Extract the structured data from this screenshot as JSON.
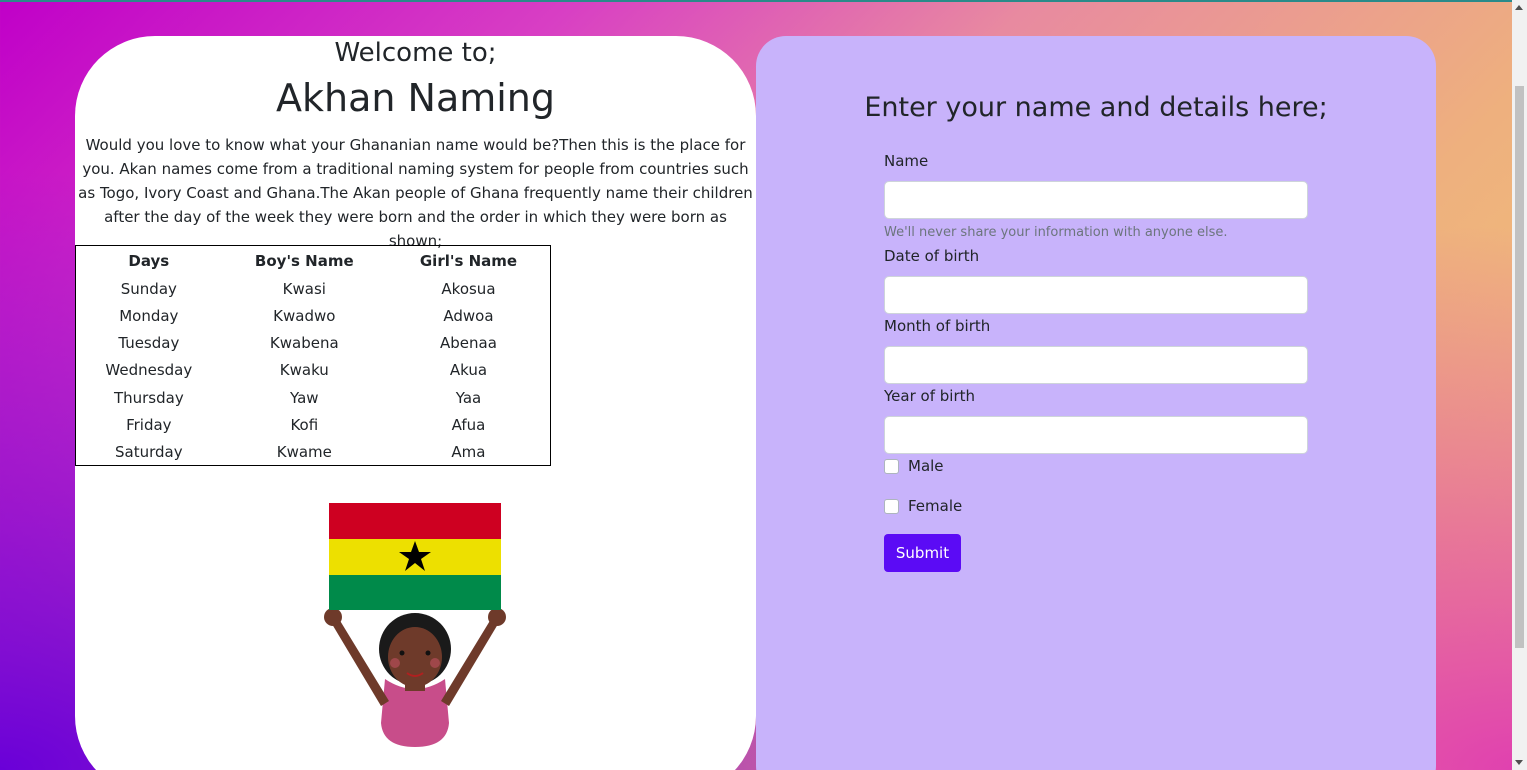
{
  "hero": {
    "welcome": "Welcome to;",
    "title": "Akhan Naming",
    "intro": "Would you love to know what your Ghananian name would be?Then this is the place for you. Akan names come from a traditional naming system for people from countries such as Togo, Ivory Coast and Ghana.The Akan people of Ghana frequently name their children after the day of the week they were born and the order in which they were born as shown;"
  },
  "table": {
    "headers": [
      "Days",
      "Boy's Name",
      "Girl's Name"
    ],
    "rows": [
      [
        "Sunday",
        "Kwasi",
        "Akosua"
      ],
      [
        "Monday",
        "Kwadwo",
        "Adwoa"
      ],
      [
        "Tuesday",
        "Kwabena",
        "Abenaa"
      ],
      [
        "Wednesday",
        "Kwaku",
        "Akua"
      ],
      [
        "Thursday",
        "Yaw",
        "Yaa"
      ],
      [
        "Friday",
        "Kofi",
        "Afua"
      ],
      [
        "Saturday",
        "Kwame",
        "Ama"
      ]
    ]
  },
  "illustration": {
    "icon": "girl-holding-ghana-flag",
    "flag_colors": [
      "#ce0021",
      "#ede000",
      "#008a4a"
    ]
  },
  "form": {
    "title": "Enter your name and details here;",
    "name_label": "Name",
    "name_value": "",
    "help_text": "We'll never share your information with anyone else.",
    "date_label": "Date of birth",
    "date_value": "",
    "month_label": "Month of birth",
    "month_value": "",
    "year_label": "Year of birth",
    "year_value": "",
    "male_label": "Male",
    "female_label": "Female",
    "submit_label": "Submit"
  },
  "colors": {
    "form_bg": "#c8b3fb",
    "submit_bg": "#5b0bf5"
  }
}
